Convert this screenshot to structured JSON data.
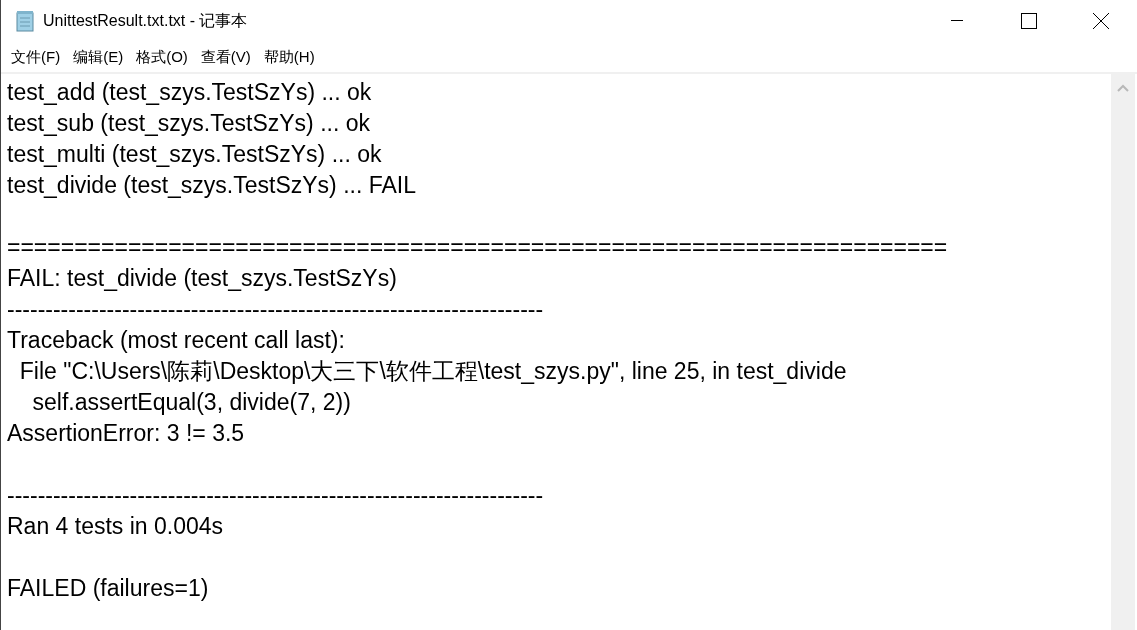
{
  "window": {
    "title": "UnittestResult.txt.txt - 记事本"
  },
  "menu": [
    "文件(F)",
    "编辑(E)",
    "格式(O)",
    "查看(V)",
    "帮助(H)"
  ],
  "document": {
    "lines": [
      {
        "kind": "text",
        "text": "test_add (test_szys.TestSzYs) ... ok"
      },
      {
        "kind": "text",
        "text": "test_sub (test_szys.TestSzYs) ... ok"
      },
      {
        "kind": "text",
        "text": "test_multi (test_szys.TestSzYs) ... ok"
      },
      {
        "kind": "text",
        "text": "test_divide (test_szys.TestSzYs) ... FAIL"
      },
      {
        "kind": "blank"
      },
      {
        "kind": "text",
        "text": "======================================================================"
      },
      {
        "kind": "text",
        "text": "FAIL: test_divide (test_szys.TestSzYs)"
      },
      {
        "kind": "text",
        "text": "----------------------------------------------------------------------"
      },
      {
        "kind": "text",
        "text": "Traceback (most recent call last):"
      },
      {
        "kind": "text",
        "text": "  File \"C:\\Users\\陈莉\\Desktop\\大三下\\软件工程\\test_szys.py\", line 25, in test_divide"
      },
      {
        "kind": "text",
        "text": "    self.assertEqual(3, divide(7, 2))"
      },
      {
        "kind": "text",
        "text": "AssertionError: 3 != 3.5"
      },
      {
        "kind": "blank"
      },
      {
        "kind": "text",
        "text": "----------------------------------------------------------------------"
      },
      {
        "kind": "text",
        "text": "Ran 4 tests in 0.004s"
      },
      {
        "kind": "blank"
      },
      {
        "kind": "text",
        "text": "FAILED (failures=1)"
      }
    ]
  }
}
